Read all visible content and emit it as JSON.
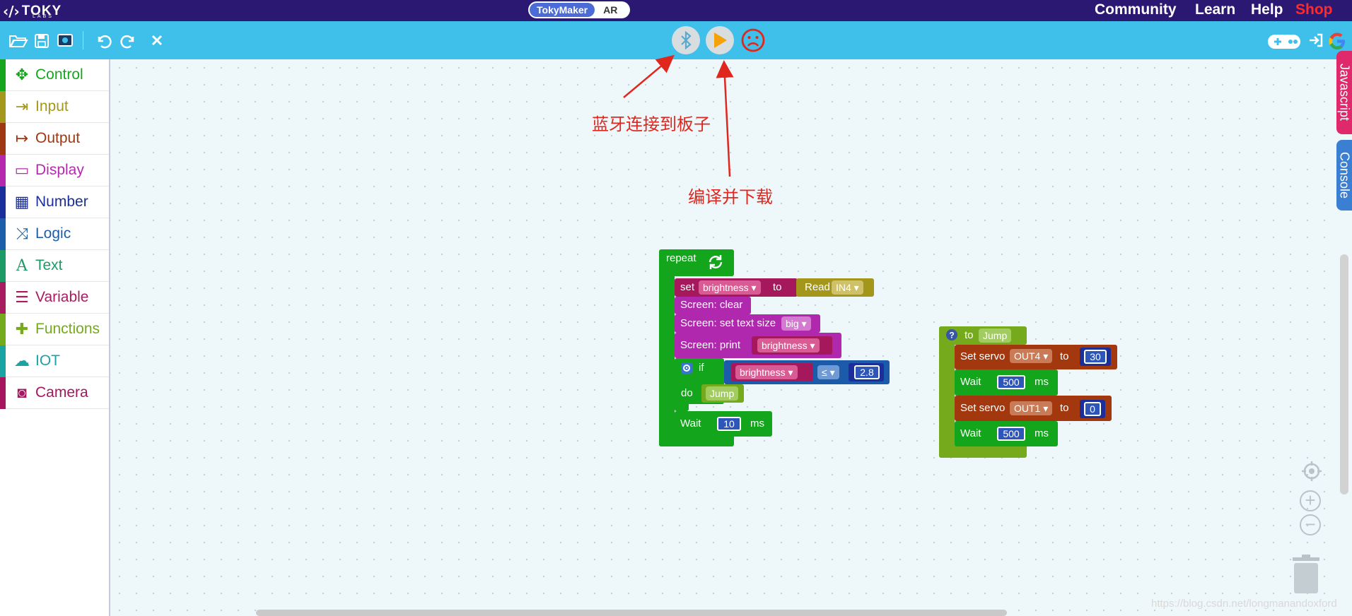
{
  "topnav": {
    "logo": {
      "mark": "‹/›",
      "word": "TOKY",
      "sub": "LABS"
    },
    "mode_active": "TokyMaker",
    "mode_inactive": "AR",
    "links": [
      "Community",
      "Learn",
      "Help",
      "Shop"
    ]
  },
  "toolbar": {
    "left_icons": [
      "open-folder-icon",
      "save-icon",
      "screenshot-icon",
      "undo-icon",
      "redo-icon",
      "clear-icon"
    ],
    "center_buttons": [
      "bluetooth-icon",
      "play-icon",
      "sad-face-icon"
    ],
    "right_icons": [
      "gamepad-icon",
      "sign-in-icon",
      "google-icon"
    ]
  },
  "categories": [
    {
      "label": "Control",
      "color": "#17a51f",
      "icon": "move-arrows-icon",
      "glyph": "✥"
    },
    {
      "label": "Input",
      "color": "#a3971c",
      "icon": "sign-in-icon",
      "glyph": "⇥"
    },
    {
      "label": "Output",
      "color": "#a03713",
      "icon": "sign-out-icon",
      "glyph": "↦"
    },
    {
      "label": "Display",
      "color": "#b52aad",
      "icon": "monitor-icon",
      "glyph": "▭"
    },
    {
      "label": "Number",
      "color": "#1a2f9a",
      "icon": "calculator-icon",
      "glyph": "▦"
    },
    {
      "label": "Logic",
      "color": "#1c5ea9",
      "icon": "shuffle-icon",
      "glyph": "⤨"
    },
    {
      "label": "Text",
      "color": "#1e9a67",
      "icon": "text-icon",
      "glyph": "A"
    },
    {
      "label": "Variable",
      "color": "#a71d60",
      "icon": "bars-icon",
      "glyph": "☰"
    },
    {
      "label": "Functions",
      "color": "#74aa1b",
      "icon": "puzzle-icon",
      "glyph": "✚"
    },
    {
      "label": "IOT",
      "color": "#1aa3a3",
      "icon": "cloud-icon",
      "glyph": "☁"
    },
    {
      "label": "Camera",
      "color": "#a6165e",
      "icon": "camera-icon",
      "glyph": "◙"
    }
  ],
  "annotations": {
    "bluetooth": "蓝牙连接到板子",
    "compile": "编译并下载"
  },
  "blocks": {
    "repeat": "repeat",
    "set": "set",
    "brightness": "brightness",
    "to": "to",
    "read": "Read",
    "in4": "IN4",
    "screen_clear": "Screen: clear",
    "screen_text_size": "Screen: set text size",
    "big": "big",
    "screen_print": "Screen: print",
    "if": "if",
    "do": "do",
    "op": "≤",
    "cmp_value": "2.8",
    "jump": "Jump",
    "wait": "Wait",
    "wait_value": "10",
    "ms": "ms",
    "to_jump_prefix": "to",
    "set_servo": "Set servo",
    "out4": "OUT4",
    "angle1": "30",
    "wait_500": "500",
    "out1": "OUT1",
    "angle2": "0"
  },
  "side_tabs": {
    "javascript": "Javascript",
    "console": "Console"
  },
  "watermark": "https://blog.csdn.net/longmanandoxford"
}
